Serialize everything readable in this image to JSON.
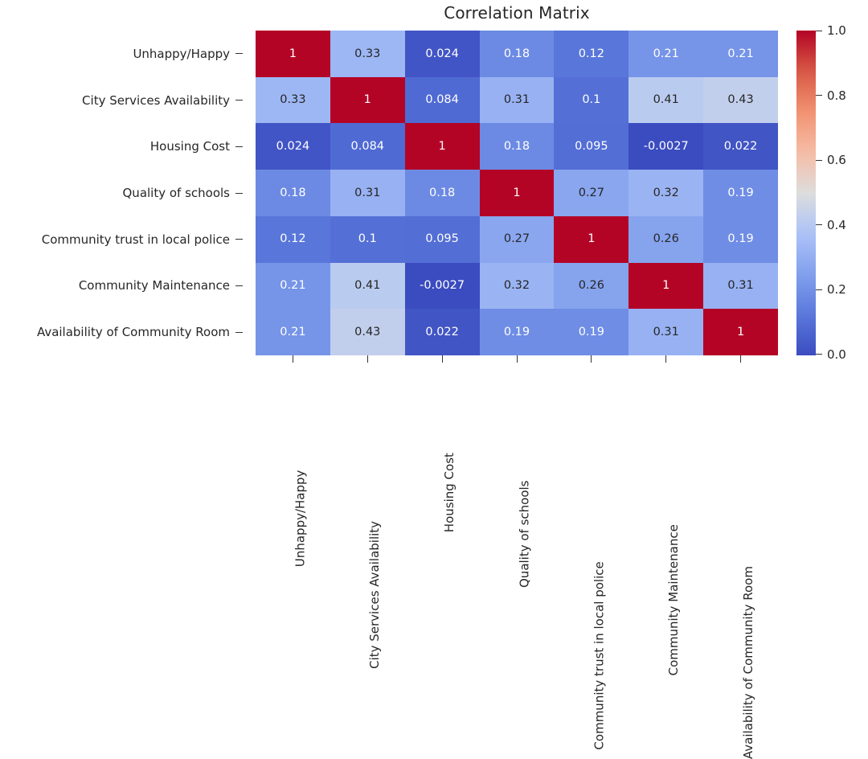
{
  "chart_data": {
    "type": "heatmap",
    "title": "Correlation Matrix",
    "xlabel": "",
    "ylabel": "",
    "grid": false,
    "legend_position": "right",
    "colormap": "coolwarm",
    "colorbar": {
      "ticks": [
        "1.0",
        "0.8",
        "0.6",
        "0.4",
        "0.2",
        "0.0"
      ],
      "tick_values": [
        1.0,
        0.8,
        0.6,
        0.4,
        0.2,
        0.0
      ],
      "vmin": -0.0027,
      "vmax": 1.0,
      "low_color": "#3b4cc0",
      "mid_color": "#dddddd",
      "high_color": "#b40426"
    },
    "categories": [
      "Unhappy/Happy",
      "City Services Availability",
      "Housing Cost",
      "Quality of schools",
      "Community trust in local police",
      "Community Maintenance",
      "Availability of Community Room"
    ],
    "x_tick_labels": [
      "Unhappy/Happy",
      "City Services Availability",
      "Housing Cost",
      "Quality of schools",
      "Community trust in local police",
      "Community Maintenance",
      "Availability of Community Room"
    ],
    "y_tick_labels": [
      "Unhappy/Happy",
      "City Services Availability",
      "Housing Cost",
      "Quality of schools",
      "Community trust in local police",
      "Community Maintenance",
      "Availability of Community Room"
    ],
    "values": [
      [
        1,
        0.33,
        0.024,
        0.18,
        0.12,
        0.21,
        0.21
      ],
      [
        0.33,
        1,
        0.084,
        0.31,
        0.1,
        0.41,
        0.43
      ],
      [
        0.024,
        0.084,
        1,
        0.18,
        0.095,
        -0.0027,
        0.022
      ],
      [
        0.18,
        0.31,
        0.18,
        1,
        0.27,
        0.32,
        0.19
      ],
      [
        0.12,
        0.1,
        0.095,
        0.27,
        1,
        0.26,
        0.19
      ],
      [
        0.21,
        0.41,
        -0.0027,
        0.32,
        0.26,
        1,
        0.31
      ],
      [
        0.21,
        0.43,
        0.022,
        0.19,
        0.19,
        0.31,
        1
      ]
    ],
    "annotations": [
      [
        "1",
        "0.33",
        "0.024",
        "0.18",
        "0.12",
        "0.21",
        "0.21"
      ],
      [
        "0.33",
        "1",
        "0.084",
        "0.31",
        "0.1",
        "0.41",
        "0.43"
      ],
      [
        "0.024",
        "0.084",
        "1",
        "0.18",
        "0.095",
        "-0.0027",
        "0.022"
      ],
      [
        "0.18",
        "0.31",
        "0.18",
        "1",
        "0.27",
        "0.32",
        "0.19"
      ],
      [
        "0.12",
        "0.1",
        "0.095",
        "0.27",
        "1",
        "0.26",
        "0.19"
      ],
      [
        "0.21",
        "0.41",
        "-0.0027",
        "0.32",
        "0.26",
        "1",
        "0.31"
      ],
      [
        "0.21",
        "0.43",
        "0.022",
        "0.19",
        "0.19",
        "0.31",
        "1"
      ]
    ]
  }
}
